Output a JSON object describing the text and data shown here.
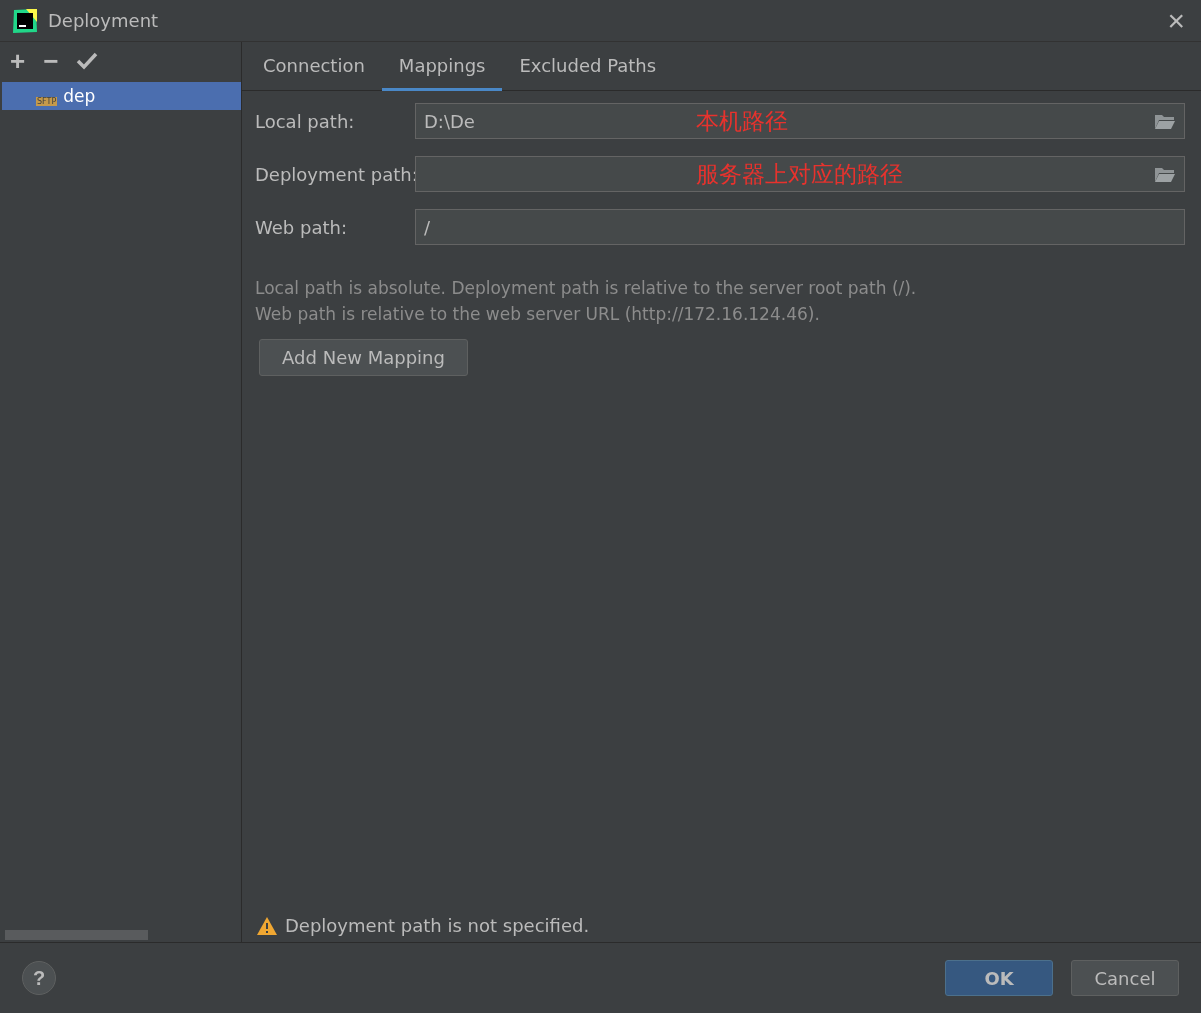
{
  "window": {
    "title": "Deployment",
    "close": "×"
  },
  "toolbar": {
    "add": "+",
    "remove": "−"
  },
  "servers": [
    {
      "label": "dep",
      "badge": "SFTP",
      "selected": true
    }
  ],
  "tabs": [
    {
      "label": "Connection",
      "selected": false
    },
    {
      "label": "Mappings",
      "selected": true
    },
    {
      "label": "Excluded Paths",
      "selected": false
    }
  ],
  "fields": [
    {
      "label": "Local path:",
      "value": "D:\\De",
      "browse": true,
      "annotation": "本机路径"
    },
    {
      "label": "Deployment path:",
      "browse": true,
      "annotation": "服务器上对应的路径"
    },
    {
      "label": "Web path:",
      "value": "/",
      "browse": false
    }
  ],
  "help_text": [
    "Local path is absolute. Deployment path is relative to the server root path (/).",
    "Web path is relative to the web server URL (http://172.16.124.46)."
  ],
  "add_button": "Add New Mapping",
  "warning": "Deployment path is not specified.",
  "footer": {
    "help": "?",
    "buttons": [
      {
        "label": "OK",
        "default": true
      },
      {
        "label": "Cancel",
        "default": false
      }
    ]
  }
}
